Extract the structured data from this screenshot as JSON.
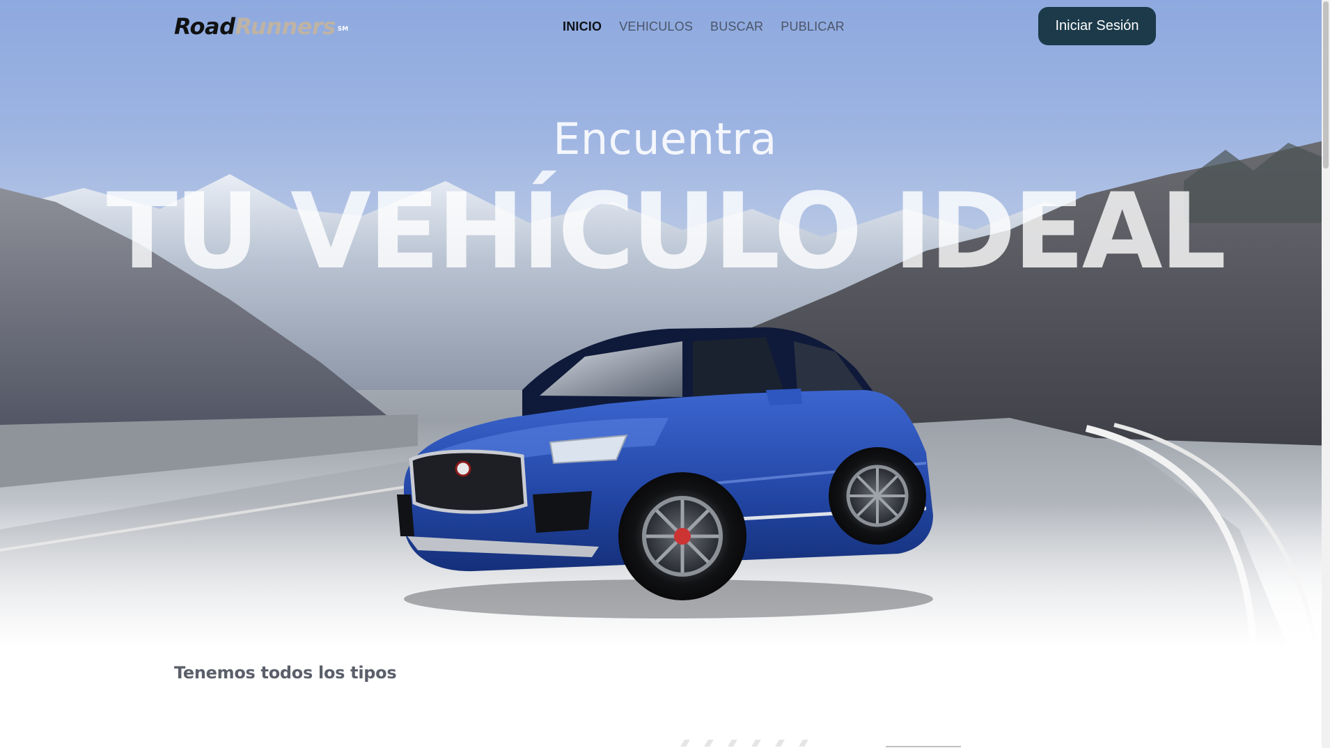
{
  "brand": {
    "name_part1": "Road",
    "name_part2": "Runners",
    "mark": "SM"
  },
  "nav": {
    "items": [
      {
        "label": "INICIO",
        "active": true
      },
      {
        "label": "VEHICULOS",
        "active": false
      },
      {
        "label": "BUSCAR",
        "active": false
      },
      {
        "label": "PUBLICAR",
        "active": false
      }
    ],
    "login_label": "Iniciar Sesión"
  },
  "hero": {
    "kicker": "Encuentra",
    "headline": "TU VEHÍCULO IDEAL"
  },
  "section": {
    "title": "Tenemos todos los tipos"
  },
  "colors": {
    "login_button": "#1c3a4a",
    "car_body": "#2b53b8",
    "sky": "#8ea9df"
  }
}
